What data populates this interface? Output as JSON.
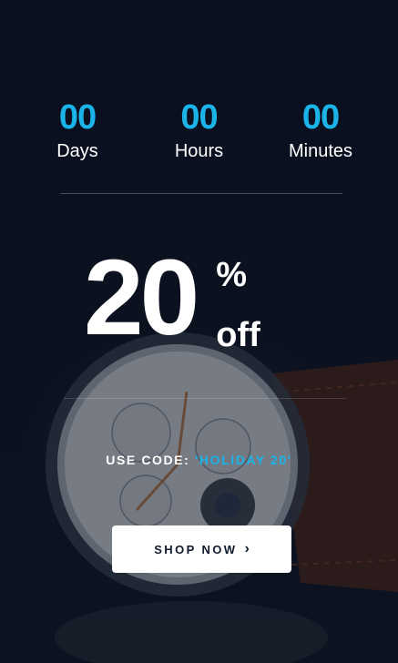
{
  "countdown": {
    "days": {
      "value": "00",
      "label": "Days"
    },
    "hours": {
      "value": "00",
      "label": "Hours"
    },
    "minutes": {
      "value": "00",
      "label": "Minutes"
    }
  },
  "offer": {
    "amount": "20",
    "percent": "%",
    "off": "off"
  },
  "promo": {
    "label": "USE CODE:",
    "code": "'HOLIDAY 20'"
  },
  "cta": {
    "label": "SHOP NOW",
    "icon": "chevron-right-icon"
  },
  "colors": {
    "accent": "#1ab4e8",
    "background": "#0b1120",
    "button": "#ffffff"
  }
}
